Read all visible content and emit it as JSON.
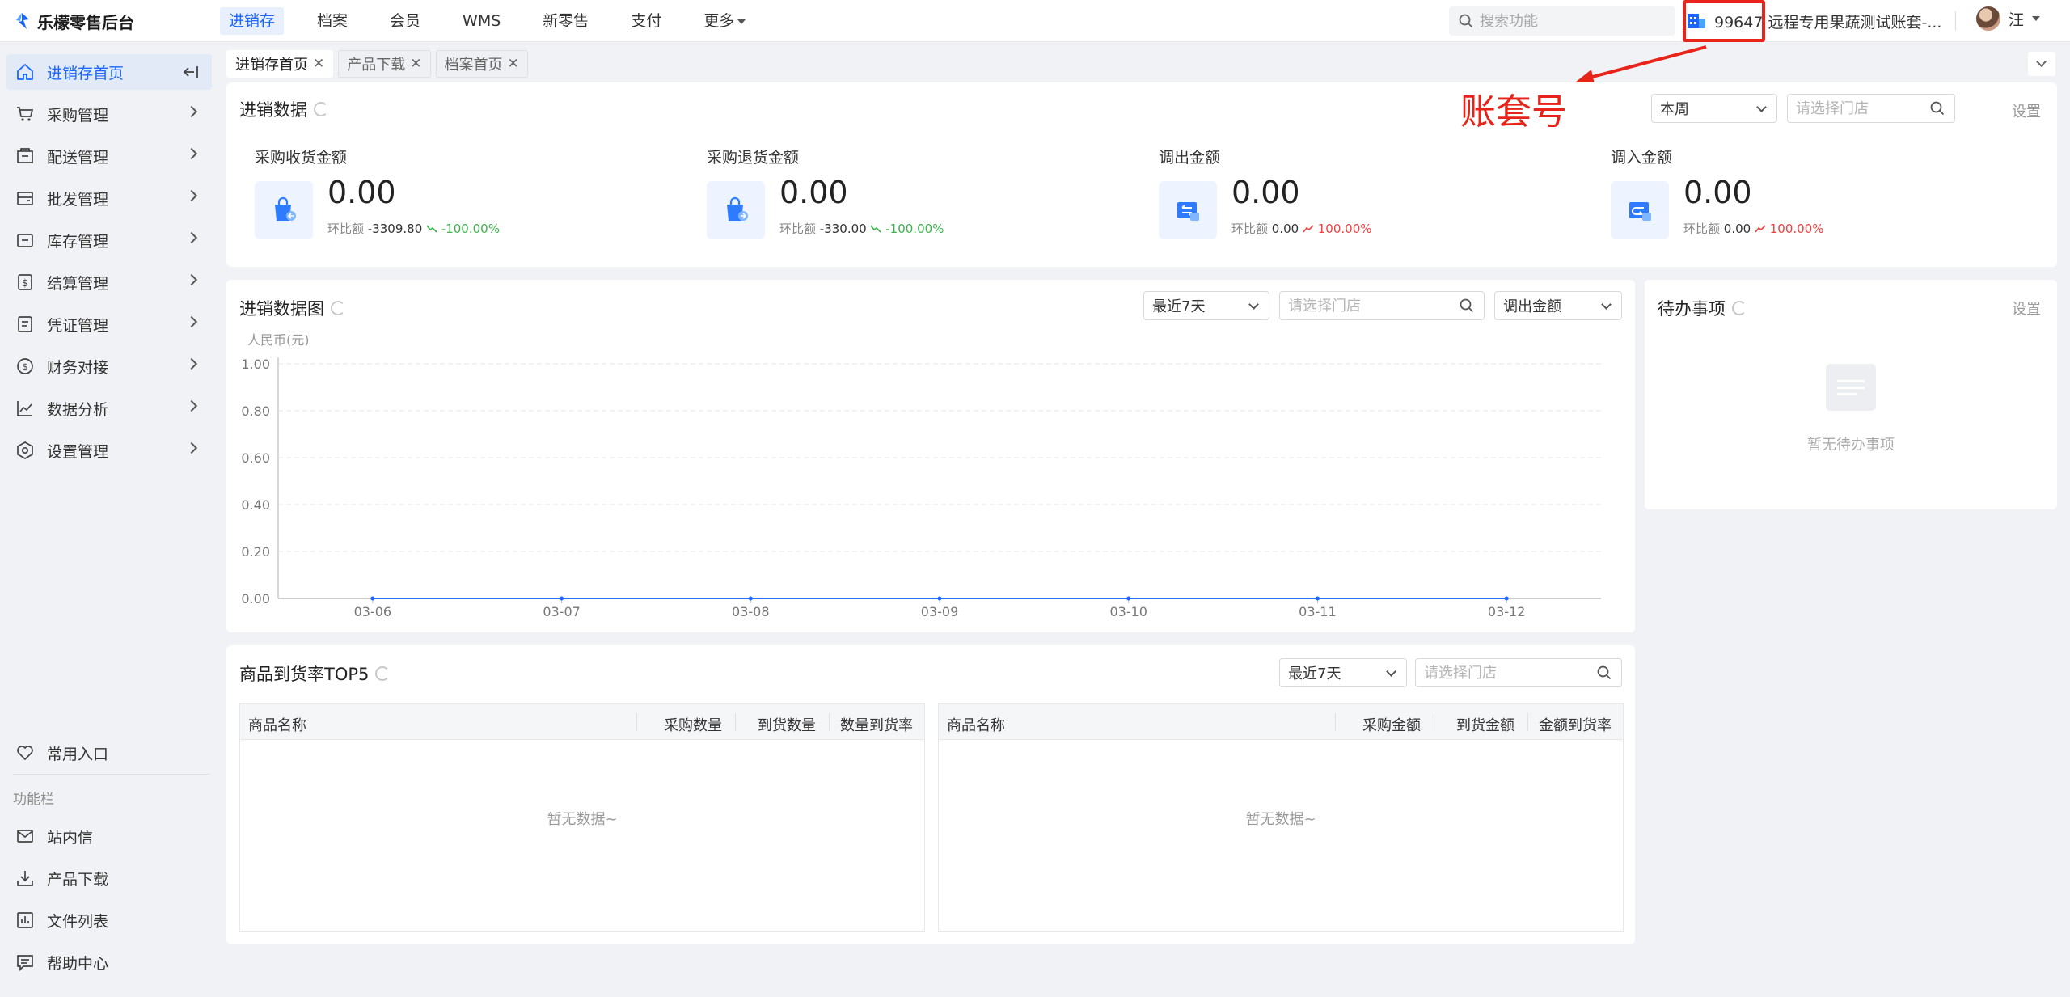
{
  "app": {
    "name": "乐檬零售后台"
  },
  "nav": [
    "进销存",
    "档案",
    "会员",
    "WMS",
    "新零售",
    "支付",
    "更多"
  ],
  "search": {
    "placeholder": "搜索功能"
  },
  "account": {
    "text": "99647 远程专用果蔬测试账套-..."
  },
  "user": {
    "name": "汪"
  },
  "sidebar": {
    "items": [
      {
        "label": "进销存首页",
        "icon": "home-icon"
      },
      {
        "label": "采购管理",
        "icon": "cart-icon"
      },
      {
        "label": "配送管理",
        "icon": "delivery-icon"
      },
      {
        "label": "批发管理",
        "icon": "wallet-icon"
      },
      {
        "label": "库存管理",
        "icon": "inventory-icon"
      },
      {
        "label": "结算管理",
        "icon": "settlement-icon"
      },
      {
        "label": "凭证管理",
        "icon": "document-icon"
      },
      {
        "label": "财务对接",
        "icon": "finance-icon"
      },
      {
        "label": "数据分析",
        "icon": "chart-icon"
      },
      {
        "label": "设置管理",
        "icon": "settings-icon"
      }
    ],
    "favorites": "常用入口",
    "section": "功能栏",
    "tools": [
      {
        "label": "站内信",
        "icon": "mail-icon"
      },
      {
        "label": "产品下载",
        "icon": "download-icon"
      },
      {
        "label": "文件列表",
        "icon": "file-list-icon"
      },
      {
        "label": "帮助中心",
        "icon": "help-icon"
      }
    ]
  },
  "tabs": [
    "进销存首页",
    "产品下载",
    "档案首页"
  ],
  "summary": {
    "title": "进销数据",
    "period": "本周",
    "store_placeholder": "请选择门店",
    "settings": "设置",
    "annotation": "账套号",
    "metrics": [
      {
        "label": "采购收货金额",
        "value": "0.00",
        "ratio_label": "环比额",
        "ratio_value": "-3309.80",
        "pct": "-100.00%",
        "trend": "down"
      },
      {
        "label": "采购退货金额",
        "value": "0.00",
        "ratio_label": "环比额",
        "ratio_value": "-330.00",
        "pct": "-100.00%",
        "trend": "down"
      },
      {
        "label": "调出金额",
        "value": "0.00",
        "ratio_label": "环比额",
        "ratio_value": "0.00",
        "pct": "100.00%",
        "trend": "up"
      },
      {
        "label": "调入金额",
        "value": "0.00",
        "ratio_label": "环比额",
        "ratio_value": "0.00",
        "pct": "100.00%",
        "trend": "up"
      }
    ]
  },
  "chart_panel": {
    "title": "进销数据图",
    "range": "最近7天",
    "store_placeholder": "请选择门店",
    "metric": "调出金额"
  },
  "chart_data": {
    "type": "line",
    "ylabel": "人民币(元)",
    "categories": [
      "03-06",
      "03-07",
      "03-08",
      "03-09",
      "03-10",
      "03-11",
      "03-12"
    ],
    "series": [
      {
        "values": [
          0,
          0,
          0,
          0,
          0,
          0,
          0
        ]
      }
    ],
    "ylim": [
      0,
      1
    ],
    "yticks": [
      "0.00",
      "0.20",
      "0.40",
      "0.60",
      "0.80",
      "1.00"
    ],
    "grid": true
  },
  "todo": {
    "title": "待办事项",
    "settings": "设置",
    "empty": "暂无待办事项"
  },
  "top5": {
    "title": "商品到货率TOP5",
    "range": "最近7天",
    "store_placeholder": "请选择门店",
    "left_headers": [
      "商品名称",
      "采购数量",
      "到货数量",
      "数量到货率"
    ],
    "right_headers": [
      "商品名称",
      "采购金额",
      "到货金额",
      "金额到货率"
    ],
    "empty": "暂无数据~"
  },
  "colors": {
    "accent": "#1a66ff",
    "annotation": "#e8231a",
    "down": "#3bb34a",
    "up": "#f04040"
  }
}
